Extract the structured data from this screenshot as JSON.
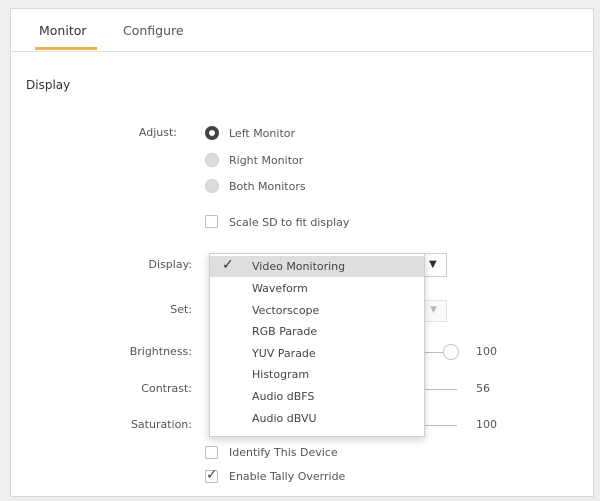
{
  "tabs": {
    "monitor": "Monitor",
    "configure": "Configure"
  },
  "section_title": "Display",
  "adjust": {
    "label": "Adjust:",
    "options": [
      "Left Monitor",
      "Right Monitor",
      "Both Monitors"
    ],
    "selected": "Left Monitor"
  },
  "scale_sd": {
    "label": "Scale SD to fit display",
    "checked": false
  },
  "display": {
    "label": "Display:",
    "options": [
      "Video Monitoring",
      "Waveform",
      "Vectorscope",
      "RGB Parade",
      "YUV Parade",
      "Histogram",
      "Audio dBFS",
      "Audio dBVU"
    ],
    "selected": "Video Monitoring",
    "check_glyph": "✓"
  },
  "set": {
    "label": "Set:"
  },
  "brightness": {
    "label": "Brightness:",
    "value": "100"
  },
  "contrast": {
    "label": "Contrast:",
    "value": "56"
  },
  "saturation": {
    "label": "Saturation:",
    "value": "100"
  },
  "identify_device": {
    "label": "Identify This Device",
    "checked": false
  },
  "tally_override": {
    "label": "Enable Tally Override",
    "checked": true,
    "check_glyph": "✓"
  },
  "colors": {
    "accent": "#f0b14a",
    "selected_bg": "#dedede"
  }
}
